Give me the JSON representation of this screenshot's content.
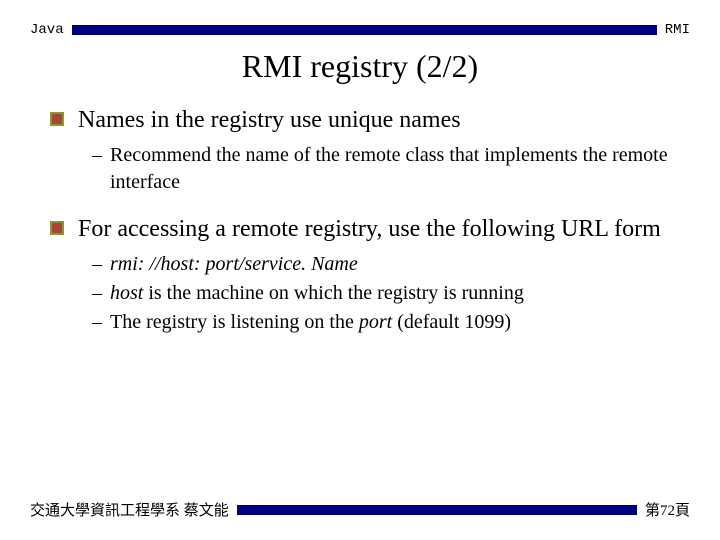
{
  "header": {
    "left": "Java",
    "right": "RMI"
  },
  "title": "RMI registry (2/2)",
  "bullets": [
    {
      "text": "Names in the registry use unique names",
      "subs": [
        {
          "plain": "Recommend the name of the remote class that implements the remote interface"
        }
      ]
    },
    {
      "text": "For accessing a remote registry, use the following URL form",
      "subs": [
        {
          "italic": "rmi: //host: port/service. Name"
        },
        {
          "host_line": {
            "prefix_italic": "host",
            "rest": " is the machine on which the registry is running"
          }
        },
        {
          "port_line": {
            "prefix": "The registry is listening on the ",
            "italic": "port",
            "suffix": " (default 1099)"
          }
        }
      ]
    }
  ],
  "footer": {
    "left": "交通大學資訊工程學系 蔡文能",
    "right": "第72頁"
  },
  "colors": {
    "bar": "#000080"
  }
}
